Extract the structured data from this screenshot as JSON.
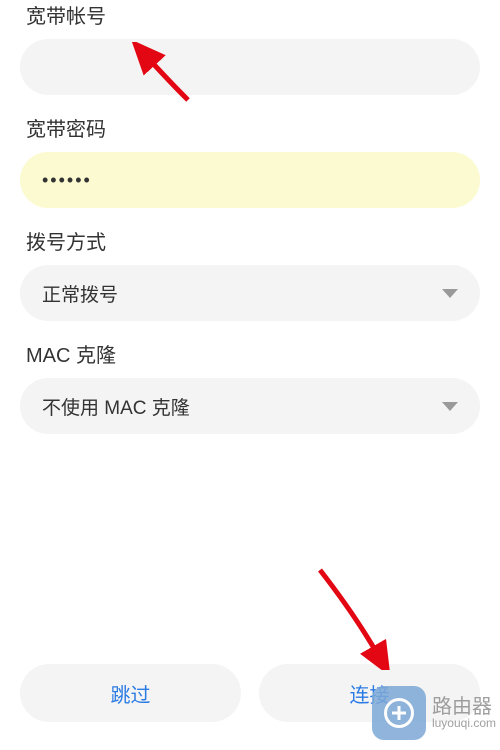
{
  "labels": {
    "broadband_account": "宽带帐号",
    "broadband_password": "宽带密码",
    "dial_method": "拨号方式",
    "mac_clone": "MAC 克隆"
  },
  "values": {
    "account": "",
    "password": "••••••",
    "dial_method": "正常拨号",
    "mac_clone": "不使用 MAC 克隆"
  },
  "buttons": {
    "skip": "跳过",
    "connect": "连接"
  },
  "watermark": {
    "title": "路由器",
    "url": "luyouqi.com"
  }
}
